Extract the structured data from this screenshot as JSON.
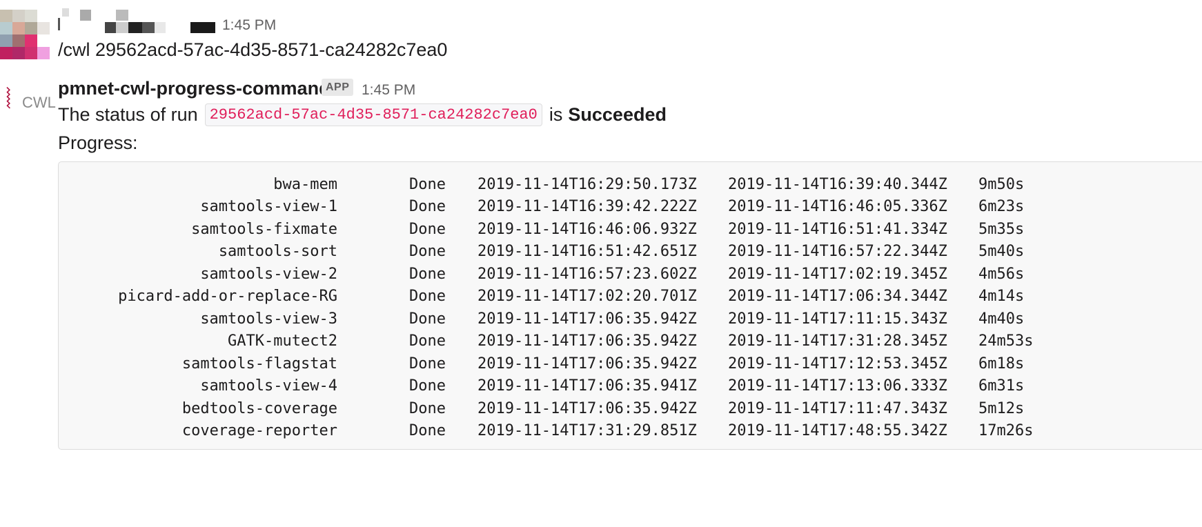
{
  "user_message": {
    "avatar_pixels": [
      "#c8c0b0",
      "#d4d0c8",
      "#dcdcd4",
      "#ffffff",
      "#b8ccd0",
      "#d8a898",
      "#b0a898",
      "#e8e4e0",
      "#90a0b0",
      "#a07070",
      "#e03070",
      "#ffffff",
      "#c02060",
      "#b02868",
      "#d03070",
      "#f0a0e0"
    ],
    "time": "1:45 PM",
    "text": "/cwl 29562acd-57ac-4d35-8571-ca24282c7ea0"
  },
  "bot_message": {
    "avatar_label": "CWL",
    "avatar_icon": "zigzag-logo",
    "name": "pmnet-cwl-progress-command",
    "badge": "APP",
    "time": "1:45 PM",
    "status_prefix": "The status of run",
    "run_id": "29562acd-57ac-4d35-8571-ca24282c7ea0",
    "status_is": "is",
    "status": "Succeeded",
    "progress_label": "Progress:",
    "rows": [
      {
        "step": "bwa-mem",
        "state": "Done",
        "start": "2019-11-14T16:29:50.173Z",
        "end": "2019-11-14T16:39:40.344Z",
        "duration": "9m50s"
      },
      {
        "step": "samtools-view-1",
        "state": "Done",
        "start": "2019-11-14T16:39:42.222Z",
        "end": "2019-11-14T16:46:05.336Z",
        "duration": "6m23s"
      },
      {
        "step": "samtools-fixmate",
        "state": "Done",
        "start": "2019-11-14T16:46:06.932Z",
        "end": "2019-11-14T16:51:41.334Z",
        "duration": "5m35s"
      },
      {
        "step": "samtools-sort",
        "state": "Done",
        "start": "2019-11-14T16:51:42.651Z",
        "end": "2019-11-14T16:57:22.344Z",
        "duration": "5m40s"
      },
      {
        "step": "samtools-view-2",
        "state": "Done",
        "start": "2019-11-14T16:57:23.602Z",
        "end": "2019-11-14T17:02:19.345Z",
        "duration": "4m56s"
      },
      {
        "step": "picard-add-or-replace-RG",
        "state": "Done",
        "start": "2019-11-14T17:02:20.701Z",
        "end": "2019-11-14T17:06:34.344Z",
        "duration": "4m14s"
      },
      {
        "step": "samtools-view-3",
        "state": "Done",
        "start": "2019-11-14T17:06:35.942Z",
        "end": "2019-11-14T17:11:15.343Z",
        "duration": "4m40s"
      },
      {
        "step": "GATK-mutect2",
        "state": "Done",
        "start": "2019-11-14T17:06:35.942Z",
        "end": "2019-11-14T17:31:28.345Z",
        "duration": "24m53s"
      },
      {
        "step": "samtools-flagstat",
        "state": "Done",
        "start": "2019-11-14T17:06:35.942Z",
        "end": "2019-11-14T17:12:53.345Z",
        "duration": "6m18s"
      },
      {
        "step": "samtools-view-4",
        "state": "Done",
        "start": "2019-11-14T17:06:35.941Z",
        "end": "2019-11-14T17:13:06.333Z",
        "duration": "6m31s"
      },
      {
        "step": "bedtools-coverage",
        "state": "Done",
        "start": "2019-11-14T17:06:35.942Z",
        "end": "2019-11-14T17:11:47.343Z",
        "duration": "5m12s"
      },
      {
        "step": "coverage-reporter",
        "state": "Done",
        "start": "2019-11-14T17:31:29.851Z",
        "end": "2019-11-14T17:48:55.342Z",
        "duration": "17m26s"
      }
    ]
  },
  "colors": {
    "code_text": "#e01e5a",
    "bot_mark": "#b0123f",
    "muted": "#616061"
  }
}
